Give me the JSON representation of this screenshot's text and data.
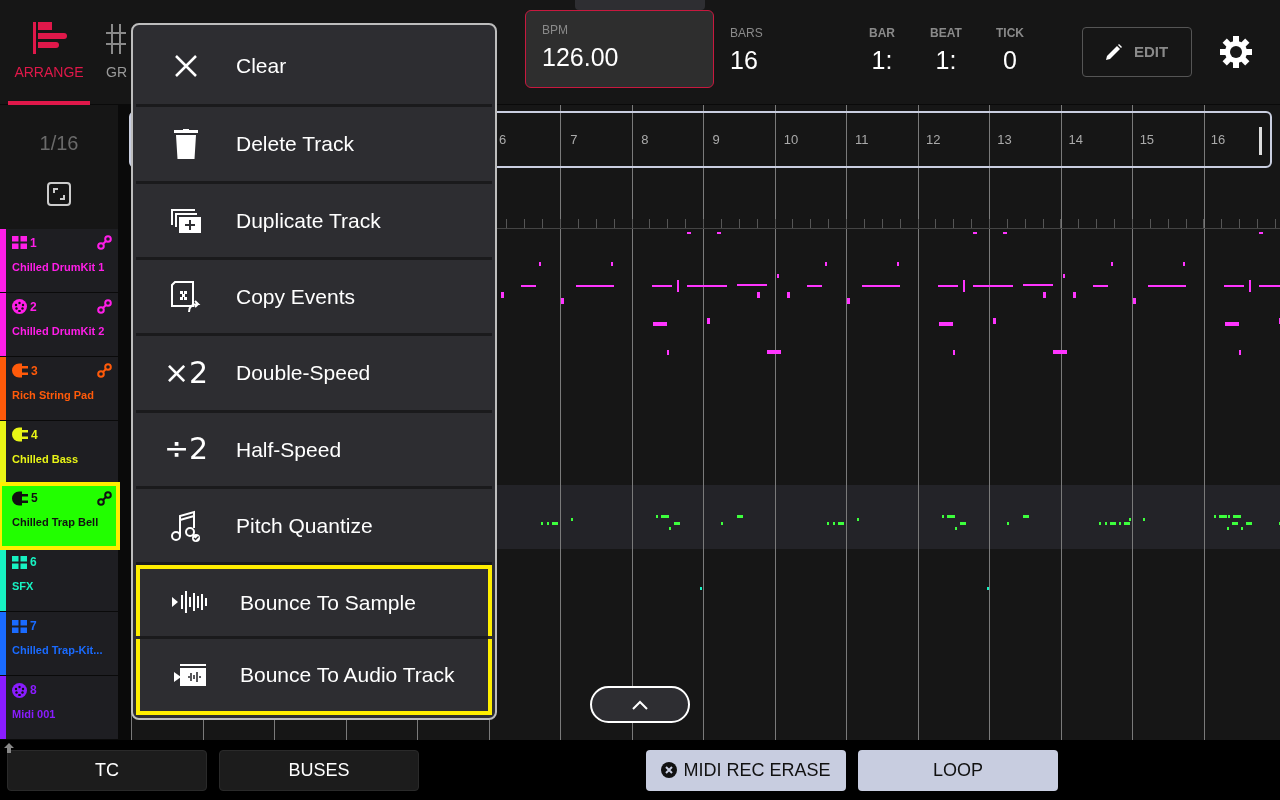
{
  "tabs": [
    {
      "label": "ARRANGE",
      "kind": "arrange",
      "selected": true
    },
    {
      "label": "GR",
      "kind": "grid",
      "selected": false
    }
  ],
  "bpm": {
    "label": "BPM",
    "value": "126.00"
  },
  "bars": {
    "label": "BARS",
    "value": "16"
  },
  "position": [
    {
      "label": "BAR",
      "value": "1:"
    },
    {
      "label": "BEAT",
      "value": "1:"
    },
    {
      "label": "TICK",
      "value": "0"
    }
  ],
  "edit_button": "EDIT",
  "zoom_label": "1/16",
  "ruler": {
    "labels": [
      "6",
      "7",
      "8",
      "9",
      "10",
      "11",
      "12",
      "13",
      "14",
      "15",
      "16"
    ]
  },
  "tracks": [
    {
      "number": "1",
      "name": "Chilled DrumKit 1",
      "kind": "pads",
      "color": "#ff1ee8",
      "linked": true,
      "selected": false
    },
    {
      "number": "2",
      "name": "Chilled DrumKit 2",
      "kind": "midi",
      "color": "#ff1ee8",
      "linked": true,
      "selected": false
    },
    {
      "number": "3",
      "name": "Rich String Pad",
      "kind": "plugin",
      "color": "#ff5a0a",
      "linked": true,
      "selected": false
    },
    {
      "number": "4",
      "name": "Chilled Bass",
      "kind": "plugin",
      "color": "#e8f516",
      "linked": false,
      "selected": false
    },
    {
      "number": "5",
      "name": "Chilled Trap Bell",
      "kind": "plugin",
      "color": "#22ff00",
      "linked": true,
      "selected": true
    },
    {
      "number": "6",
      "name": "SFX",
      "kind": "pads",
      "color": "#17f2c2",
      "linked": false,
      "selected": false
    },
    {
      "number": "7",
      "name": "Chilled Trap-Kit...",
      "kind": "pads",
      "color": "#1a6bff",
      "linked": false,
      "selected": false
    },
    {
      "number": "8",
      "name": "Midi 001",
      "kind": "midi",
      "color": "#8a1cff",
      "linked": false,
      "selected": false
    }
  ],
  "menu": [
    {
      "label": "Clear",
      "kind": "clear",
      "highlighted": false
    },
    {
      "label": "Delete Track",
      "kind": "delete",
      "highlighted": false
    },
    {
      "label": "Duplicate Track",
      "kind": "duplicate",
      "highlighted": false
    },
    {
      "label": "Copy Events",
      "kind": "copy",
      "highlighted": false
    },
    {
      "label": "Double-Speed",
      "kind": "symbol",
      "symbol": "×2",
      "highlighted": false
    },
    {
      "label": "Half-Speed",
      "kind": "symbol",
      "symbol": "÷2",
      "highlighted": false
    },
    {
      "label": "Pitch Quantize",
      "kind": "pitch",
      "highlighted": false
    },
    {
      "label": "Bounce To Sample",
      "kind": "bounce-sample",
      "highlighted": true
    },
    {
      "label": "Bounce To Audio Track",
      "kind": "bounce-audio",
      "highlighted": true
    }
  ],
  "bottom_buttons": [
    {
      "label": "TC",
      "kind": "dark"
    },
    {
      "label": "BUSES",
      "kind": "dark"
    },
    {
      "label": "MIDI REC ERASE",
      "kind": "erase"
    },
    {
      "label": "LOOP",
      "kind": "light"
    }
  ]
}
